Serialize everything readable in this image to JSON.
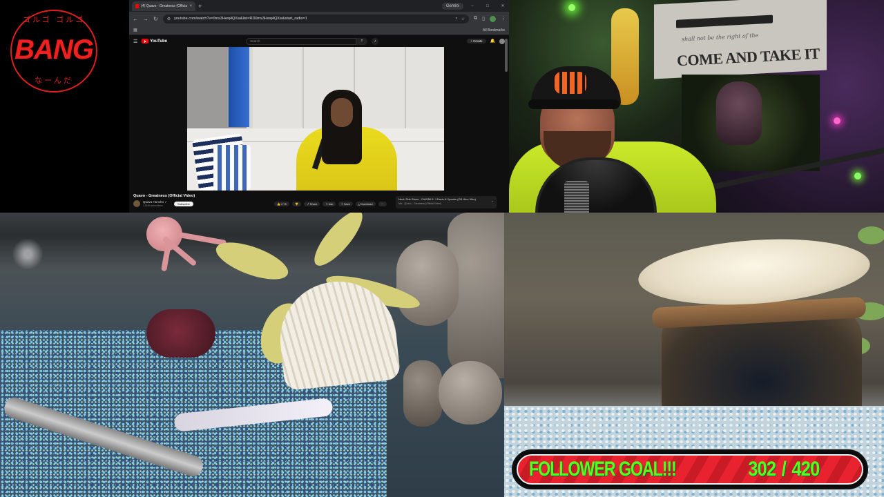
{
  "logo": {
    "ring_top": "ゴルゴ ゴルゴ",
    "word": "BANG",
    "ring_bottom": "なーんだ"
  },
  "browser": {
    "tab": {
      "title": "(4) Quavo - Greatness (Official Vi...",
      "close": "×"
    },
    "new_tab": "+",
    "gemini_label": "Gemini",
    "url": "youtube.com/watch?v=0ms3Hwq4QXw&list=RD0ms3Hwq4QXw&start_radio=1",
    "bookmarks_label": "All Bookmarks",
    "youtube": {
      "logo_text": "YouTube",
      "search_placeholder": "Search",
      "create_label": "+ Create",
      "video_title": "Quavo - Greatness (Official Video)",
      "channel_name": "Quavo Huncho ✓",
      "channel_subs": "1.81M subscribers",
      "subscribe_label": "Subscribe",
      "actions": [
        "👍 2.7K",
        "👎",
        "↗ Share",
        "✦ Ask",
        "≡ Save",
        "⤓ Download",
        "⋯"
      ],
      "next_line": "Next: Rob Stone · Chill Bill ft. J.Davis & Spooks (Off. Alco Vibe)",
      "mix_line": "Mix - Quavo - Greatness (Official Video)"
    }
  },
  "webcam": {
    "flag_subtext": "shall not be the right of the",
    "flag_text": "COME AND TAKE IT"
  },
  "follower_goal": {
    "label": "FOLLOWER GOAL!!!",
    "current": "302",
    "separator": "/",
    "target": "420",
    "accent_color": "#56ff1e",
    "bar_color": "#e8232f"
  }
}
